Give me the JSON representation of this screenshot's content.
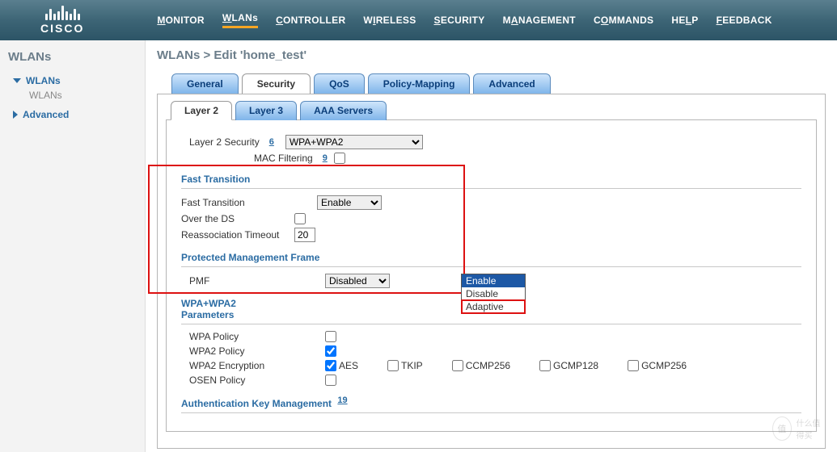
{
  "brand": "CISCO",
  "nav": {
    "monitor": "MONITOR",
    "wlans": "WLANs",
    "controller": "CONTROLLER",
    "wireless": "WIRELESS",
    "security": "SECURITY",
    "management": "MANAGEMENT",
    "commands": "COMMANDS",
    "help": "HELP",
    "feedback": "FEEDBACK"
  },
  "sidebar": {
    "title": "WLANs",
    "wlans": "WLANs",
    "wlans_sub": "WLANs",
    "advanced": "Advanced"
  },
  "crumb": "WLANs > Edit  'home_test'",
  "tabs": {
    "general": "General",
    "security": "Security",
    "qos": "QoS",
    "policy": "Policy-Mapping",
    "advanced": "Advanced"
  },
  "subtabs": {
    "layer2": "Layer 2",
    "layer3": "Layer 3",
    "aaa": "AAA Servers"
  },
  "l2": {
    "security_label": "Layer 2 Security",
    "security_foot": "6",
    "security_value": "WPA+WPA2",
    "macfilter_label": "MAC Filtering",
    "macfilter_foot": "9"
  },
  "ft": {
    "title": "Fast Transition",
    "ft_label": "Fast Transition",
    "ft_value": "Enable",
    "ft_options": [
      "Enable",
      "Disable",
      "Adaptive"
    ],
    "over_ds_label": "Over the DS",
    "reassoc_label": "Reassociation Timeout",
    "reassoc_value": "20"
  },
  "pmf": {
    "title": "Protected Management Frame",
    "label": "PMF",
    "value": "Disabled"
  },
  "wpa": {
    "title": "WPA+WPA2 Parameters",
    "wpa_policy": "WPA Policy",
    "wpa2_policy": "WPA2 Policy",
    "wpa2_enc": "WPA2 Encryption",
    "osen": "OSEN Policy",
    "enc": {
      "aes": "AES",
      "tkip": "TKIP",
      "ccmp256": "CCMP256",
      "gcmp128": "GCMP128",
      "gcmp256": "GCMP256"
    }
  },
  "akm": {
    "title": "Authentication Key Management",
    "foot": "19"
  },
  "watermark": "什么值得买"
}
